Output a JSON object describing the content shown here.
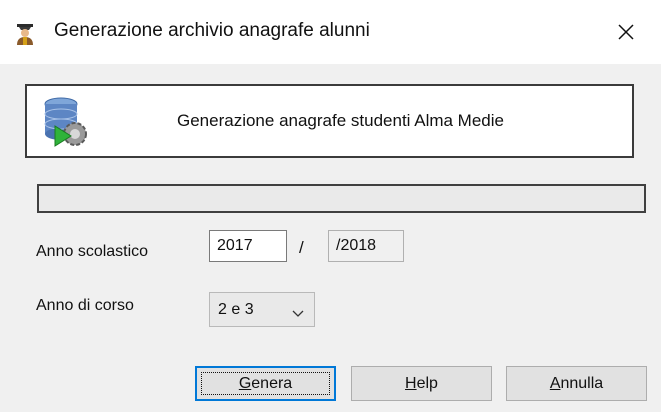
{
  "window": {
    "title": "Generazione archivio anagrafe alunni",
    "title_icon": "student-graduate-icon",
    "close_icon": "close-icon"
  },
  "header": {
    "icon": "database-gear-play-icon",
    "text": "Generazione anagrafe studenti Alma Medie"
  },
  "progress": {
    "value": 0
  },
  "form": {
    "anno_scolastico": {
      "label": "Anno scolastico",
      "start_value": "2017",
      "separator": "/",
      "end_value": "/2018"
    },
    "anno_di_corso": {
      "label": "Anno di corso",
      "selected": "2 e 3"
    }
  },
  "buttons": {
    "genera": {
      "accel": "G",
      "rest": "enera"
    },
    "help": {
      "accel": "H",
      "rest": "elp"
    },
    "annulla": {
      "accel": "A",
      "rest": "nnulla"
    }
  },
  "colors": {
    "accent": "#0078d7",
    "client_bg": "#f0f0f0",
    "button_bg": "#e1e1e1"
  }
}
